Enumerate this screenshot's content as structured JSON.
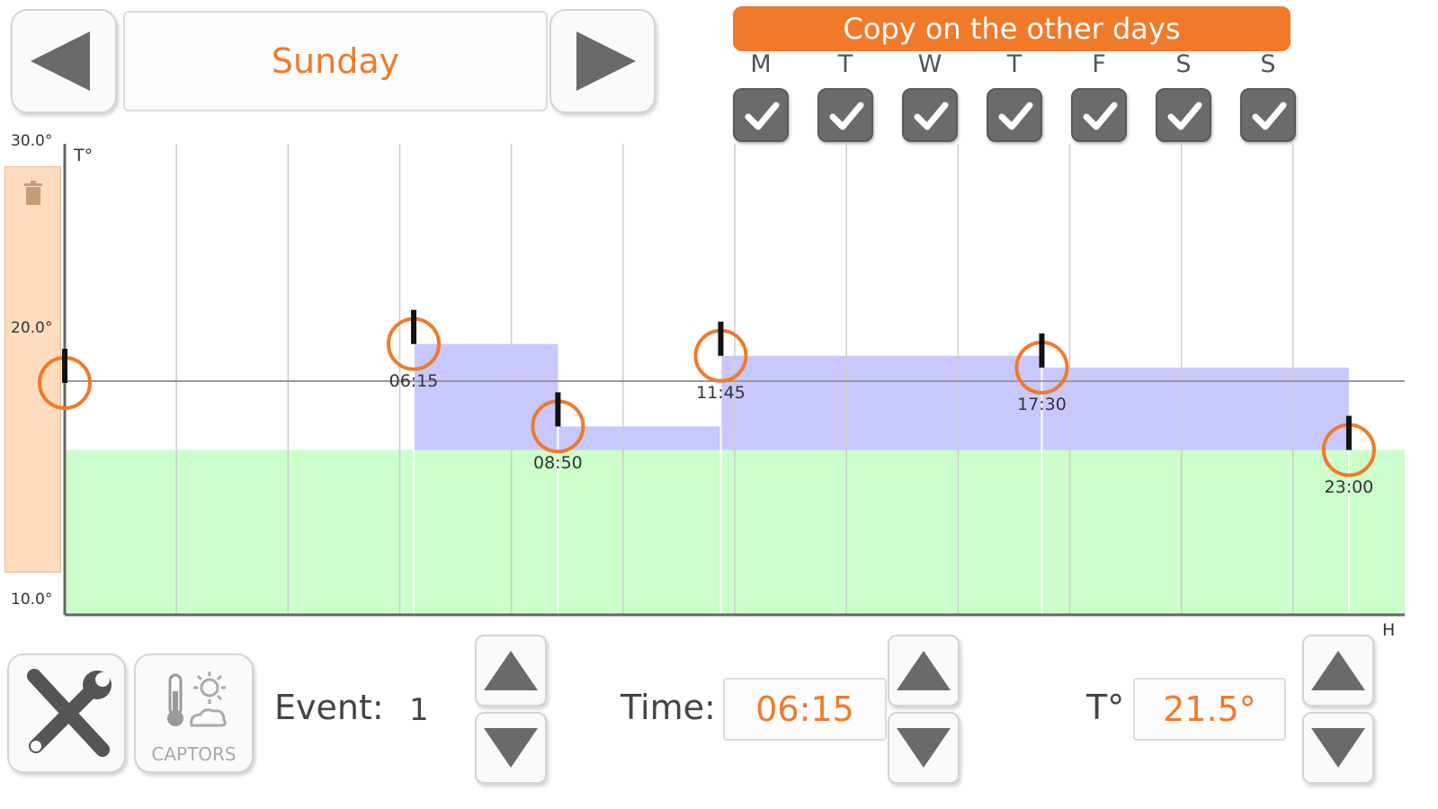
{
  "header": {
    "day": "Sunday",
    "copy_label": "Copy on the other days",
    "weekdays": [
      {
        "letter": "M",
        "checked": true
      },
      {
        "letter": "T",
        "checked": true
      },
      {
        "letter": "W",
        "checked": true
      },
      {
        "letter": "T",
        "checked": true
      },
      {
        "letter": "F",
        "checked": true
      },
      {
        "letter": "S",
        "checked": true
      },
      {
        "letter": "S",
        "checked": true
      }
    ]
  },
  "chart": {
    "y_axis_label": "T°",
    "x_axis_label": "H",
    "y_ticks": [
      "30.0°",
      "20.0°",
      "10.0°"
    ],
    "icons": {
      "delete": "trash-icon",
      "event": "thermometer-marker-icon"
    },
    "colors": {
      "accent": "#f07a2a",
      "schedule_fill": "#c8c8ff",
      "base_fill": "#ccffcc",
      "delete_zone": "#ffdcbe"
    }
  },
  "chart_data": {
    "type": "area",
    "x_unit": "hours",
    "y_unit": "°C",
    "ylim": [
      10,
      30
    ],
    "baseline_temp": 17.0,
    "x_range": [
      "00:00",
      "24:00"
    ],
    "events": [
      {
        "time": "00:00",
        "label": "",
        "temp": 16.0
      },
      {
        "time": "06:15",
        "label": "06:15",
        "temp": 21.5
      },
      {
        "time": "08:50",
        "label": "08:50",
        "temp": 18.0
      },
      {
        "time": "11:45",
        "label": "11:45",
        "temp": 21.0
      },
      {
        "time": "17:30",
        "label": "17:30",
        "temp": 20.5
      },
      {
        "time": "23:00",
        "label": "23:00",
        "temp": 17.0
      }
    ]
  },
  "footer": {
    "tools_icon": "wrench-screwdriver-icon",
    "captors_label": "CAPTORS",
    "captors_icon": "thermometer-sun-cloud-icon",
    "event_label": "Event:",
    "event_value": "1",
    "time_label": "Time:",
    "time_value": "06:15",
    "temp_label": "T°",
    "temp_value": "21.5°"
  }
}
